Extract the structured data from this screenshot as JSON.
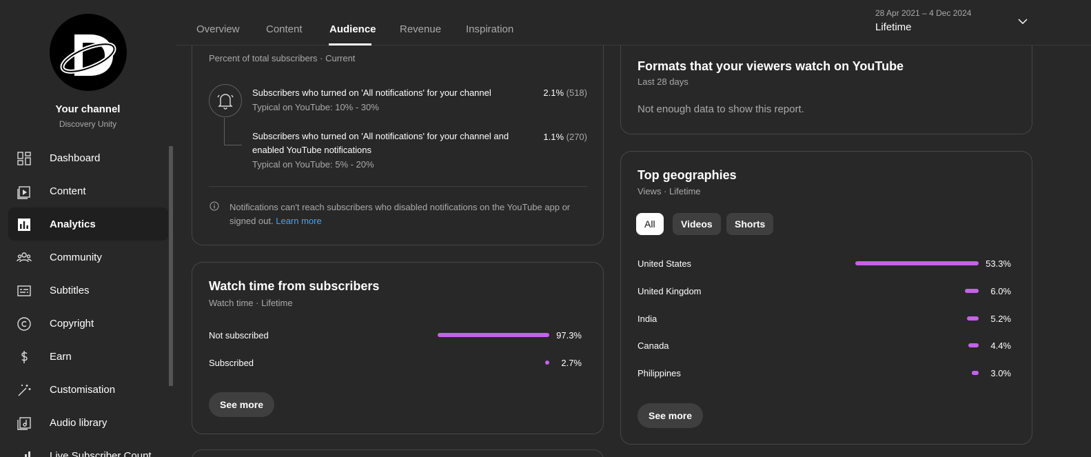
{
  "channel": {
    "name": "Your channel",
    "handle": "Discovery Unity"
  },
  "sidebar": {
    "items": [
      {
        "label": "Dashboard",
        "icon": "dashboard-icon"
      },
      {
        "label": "Content",
        "icon": "content-icon"
      },
      {
        "label": "Analytics",
        "icon": "analytics-icon",
        "active": true
      },
      {
        "label": "Community",
        "icon": "community-icon"
      },
      {
        "label": "Subtitles",
        "icon": "subtitles-icon"
      },
      {
        "label": "Copyright",
        "icon": "copyright-icon"
      },
      {
        "label": "Earn",
        "icon": "earn-icon"
      },
      {
        "label": "Customisation",
        "icon": "customisation-icon"
      },
      {
        "label": "Audio library",
        "icon": "audio-library-icon"
      },
      {
        "label": "Live Subscriber Count",
        "icon": "live-subscriber-icon"
      }
    ]
  },
  "header": {
    "tabs": [
      {
        "label": "Overview"
      },
      {
        "label": "Content"
      },
      {
        "label": "Audience",
        "active": true
      },
      {
        "label": "Revenue"
      },
      {
        "label": "Inspiration"
      }
    ],
    "date_range": "28 Apr 2021 – 4 Dec 2024",
    "period": "Lifetime"
  },
  "notifications_card": {
    "subtitle": "Percent of total subscribers · Current",
    "rows": [
      {
        "text": "Subscribers who turned on 'All notifications' for your channel",
        "typical": "Typical on YouTube: 10% - 30%",
        "pct": "2.1%",
        "count": "(518)"
      },
      {
        "text": "Subscribers who turned on 'All notifications' for your channel and enabled YouTube notifications",
        "typical": "Typical on YouTube: 5% - 20%",
        "pct": "1.1%",
        "count": "(270)"
      }
    ],
    "info": "Notifications can't reach subscribers who disabled notifications on the YouTube app or signed out.",
    "info_link": "Learn more"
  },
  "watch_card": {
    "title": "Watch time from subscribers",
    "subtitle": "Watch time · Lifetime",
    "rows": [
      {
        "label": "Not subscribed",
        "value": "97.3%",
        "fraction": 0.973
      },
      {
        "label": "Subscribed",
        "value": "2.7%",
        "fraction": 0.027
      }
    ],
    "button": "See more"
  },
  "formats_card": {
    "title": "Formats that your viewers watch on YouTube",
    "subtitle": "Last 28 days",
    "empty": "Not enough data to show this report."
  },
  "geo_card": {
    "title": "Top geographies",
    "subtitle": "Views · Lifetime",
    "chips": [
      {
        "label": "All",
        "active": true
      },
      {
        "label": "Videos"
      },
      {
        "label": "Shorts"
      }
    ],
    "rows": [
      {
        "label": "United States",
        "value": "53.3%",
        "fraction": 0.533
      },
      {
        "label": "United Kingdom",
        "value": "6.0%",
        "fraction": 0.06
      },
      {
        "label": "India",
        "value": "5.2%",
        "fraction": 0.052
      },
      {
        "label": "Canada",
        "value": "4.4%",
        "fraction": 0.044
      },
      {
        "label": "Philippines",
        "value": "3.0%",
        "fraction": 0.03
      }
    ],
    "button": "See more"
  },
  "colors": {
    "background": "#282828",
    "bar": "#c562ea",
    "link": "#3ea6ff"
  }
}
